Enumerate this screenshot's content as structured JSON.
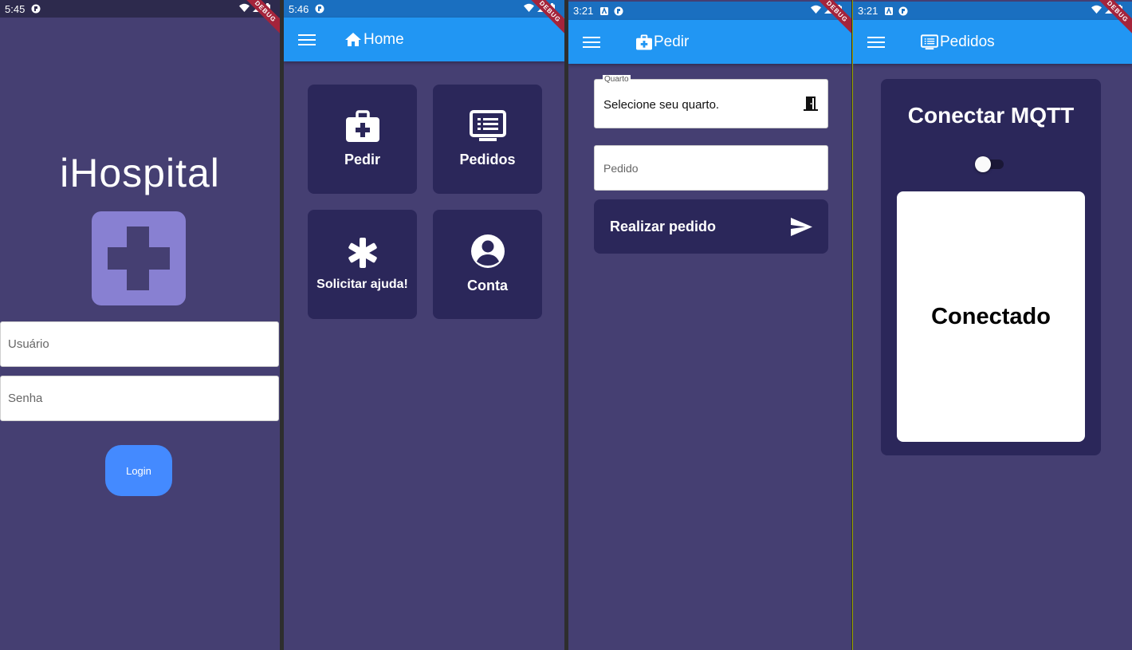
{
  "screens": {
    "login": {
      "status_time": "5:45",
      "debug_label": "DEBUG",
      "app_name": "iHospital",
      "logo_icon": "medical-cross-icon",
      "username": {
        "value": "",
        "placeholder": "Usuário"
      },
      "password": {
        "value": "",
        "placeholder": "Senha"
      },
      "login_label": "Login"
    },
    "home": {
      "status_time": "5:46",
      "debug_label": "DEBUG",
      "title": "Home",
      "title_icon": "home-icon",
      "tiles": [
        {
          "label": "Pedir",
          "icon": "medical-bag-icon"
        },
        {
          "label": "Pedidos",
          "icon": "list-monitor-icon"
        },
        {
          "label": "Solicitar ajuda!",
          "icon": "asterisk-icon"
        },
        {
          "label": "Conta",
          "icon": "account-circle-icon"
        }
      ]
    },
    "pedir": {
      "status_time": "3:21",
      "debug_label": "DEBUG",
      "title": "Pedir",
      "title_icon": "medical-bag-icon",
      "room_field": {
        "label": "Quarto",
        "value": "Selecione seu quarto.",
        "icon": "door-icon"
      },
      "order_field": {
        "value": "",
        "placeholder": "Pedido"
      },
      "submit_label": "Realizar pedido",
      "submit_icon": "send-icon"
    },
    "pedidos": {
      "status_time": "3:21",
      "debug_label": "DEBUG",
      "title": "Pedidos",
      "title_icon": "list-monitor-icon",
      "card_title": "Conectar MQTT",
      "switch_on": false,
      "status_text": "Conectado"
    }
  },
  "colors": {
    "background": "#453f72",
    "appbar": "#2196f3",
    "statusbar": "#1a6fc0",
    "tile": "#2b275a",
    "logo": "#8880d2",
    "login_button": "#448aff",
    "debug_ribbon": "#a4243b"
  }
}
